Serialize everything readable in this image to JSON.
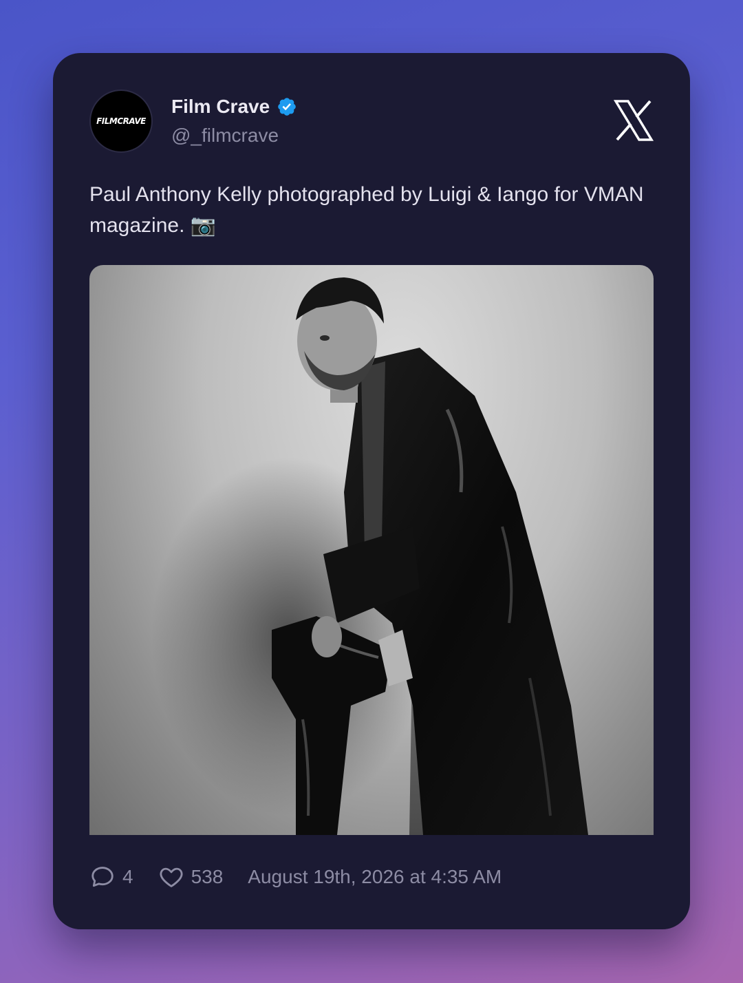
{
  "tweet": {
    "account": {
      "display_name": "Film Crave",
      "handle": "@_filmcrave",
      "verified": true,
      "avatar_text": "FILMCRAVE"
    },
    "platform_icon": "x-logo-icon",
    "text": "Paul Anthony Kelly photographed by Luigi & Iango for VMAN magazine. 📷",
    "media": {
      "kind": "black-and-white photograph"
    },
    "stats": {
      "replies": "4",
      "likes": "538"
    },
    "timestamp": "August 19th, 2026 at 4:35 AM"
  },
  "colors": {
    "background_gradient": [
      "#4a55c8",
      "#a866b0"
    ],
    "card_background": "#1b1a33",
    "primary_text": "#eceaf3",
    "secondary_text": "#8d8ca4",
    "verified_badge": "#1d9bf0"
  },
  "icons": {
    "reply": "speech-bubble-icon",
    "like": "heart-icon",
    "verified": "verified-badge-icon",
    "camera": "camera-emoji"
  }
}
